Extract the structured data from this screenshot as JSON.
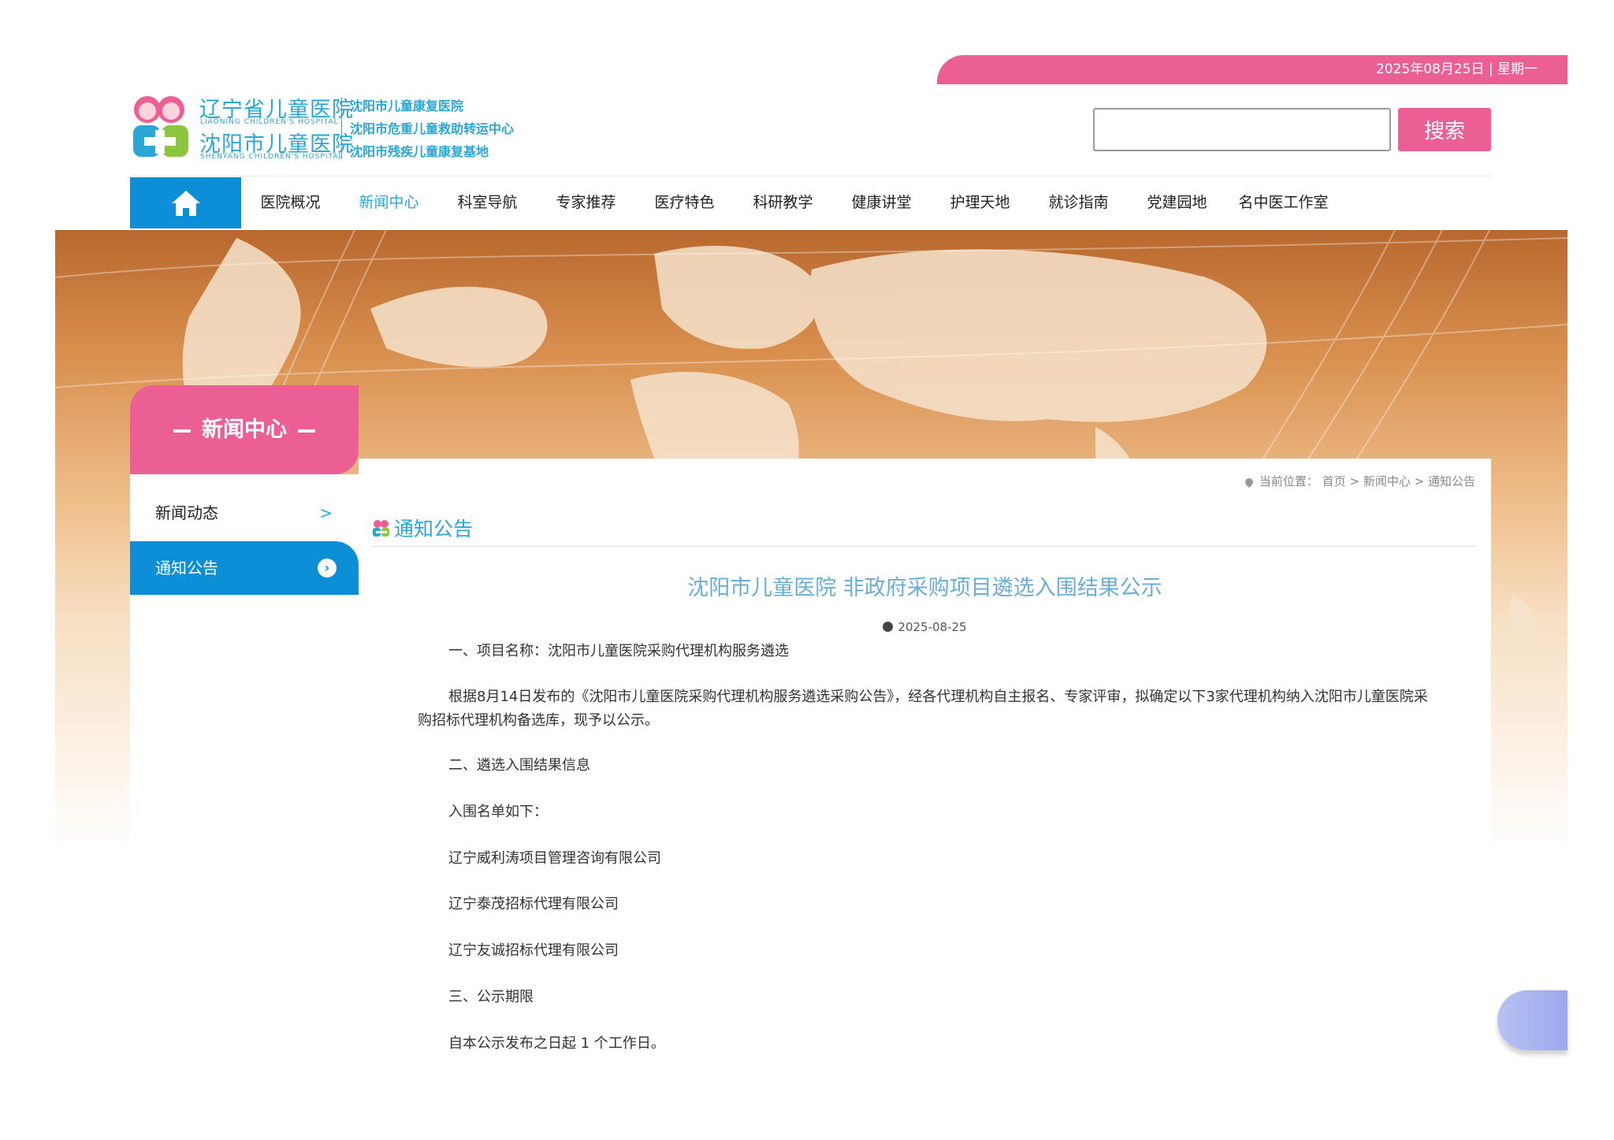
{
  "header": {
    "date_text": "2025年08月25日 | 星期一",
    "logo": {
      "cn_name_1": "辽宁省儿童医院",
      "en_name_1": "LIAONING CHILDREN'S HOSPITAL",
      "cn_name_2": "沈阳市儿童医院",
      "en_name_2": "SHENYANG CHILDREN'S HOSPITAL",
      "sub_names": [
        "沈阳市儿童康复医院",
        "沈阳市危重儿童救助转运中心",
        "沈阳市残疾儿童康复基地"
      ]
    },
    "search": {
      "value": "",
      "button_label": "搜索"
    }
  },
  "nav": {
    "home_icon": "home-icon",
    "items": [
      "医院概况",
      "新闻中心",
      "科室导航",
      "专家推荐",
      "医疗特色",
      "科研教学",
      "健康讲堂",
      "护理天地",
      "就诊指南",
      "党建园地",
      "名中医工作室"
    ],
    "active_index": 1
  },
  "sidebar": {
    "title": "新闻中心",
    "items": [
      {
        "label": "新闻动态",
        "active": false
      },
      {
        "label": "通知公告",
        "active": true
      }
    ]
  },
  "breadcrumb": {
    "prefix": "当前位置：",
    "items": [
      "首页",
      "新闻中心",
      "通知公告"
    ],
    "separator": ">"
  },
  "section": {
    "title": "通知公告"
  },
  "article": {
    "title": "沈阳市儿童医院 非政府采购项目遴选入围结果公示",
    "date": "2025-08-25",
    "paragraphs": [
      "一、项目名称：沈阳市儿童医院采购代理机构服务遴选",
      "根据8月14日发布的《沈阳市儿童医院采购代理机构服务遴选采购公告》，经各代理机构自主报名、专家评审，拟确定以下3家代理机构纳入沈阳市儿童医院采购招标代理机构备选库，现予以公示。",
      "二、遴选入围结果信息",
      "入围名单如下：",
      "辽宁威利涛项目管理咨询有限公司",
      "辽宁泰茂招标代理有限公司",
      "辽宁友诚招标代理有限公司",
      "三、公示期限",
      "自本公示发布之日起  1 个工作日。"
    ]
  },
  "colors": {
    "pink": "#ec5f95",
    "blue": "#0d8fd8",
    "title_blue": "#2ba6d5"
  }
}
